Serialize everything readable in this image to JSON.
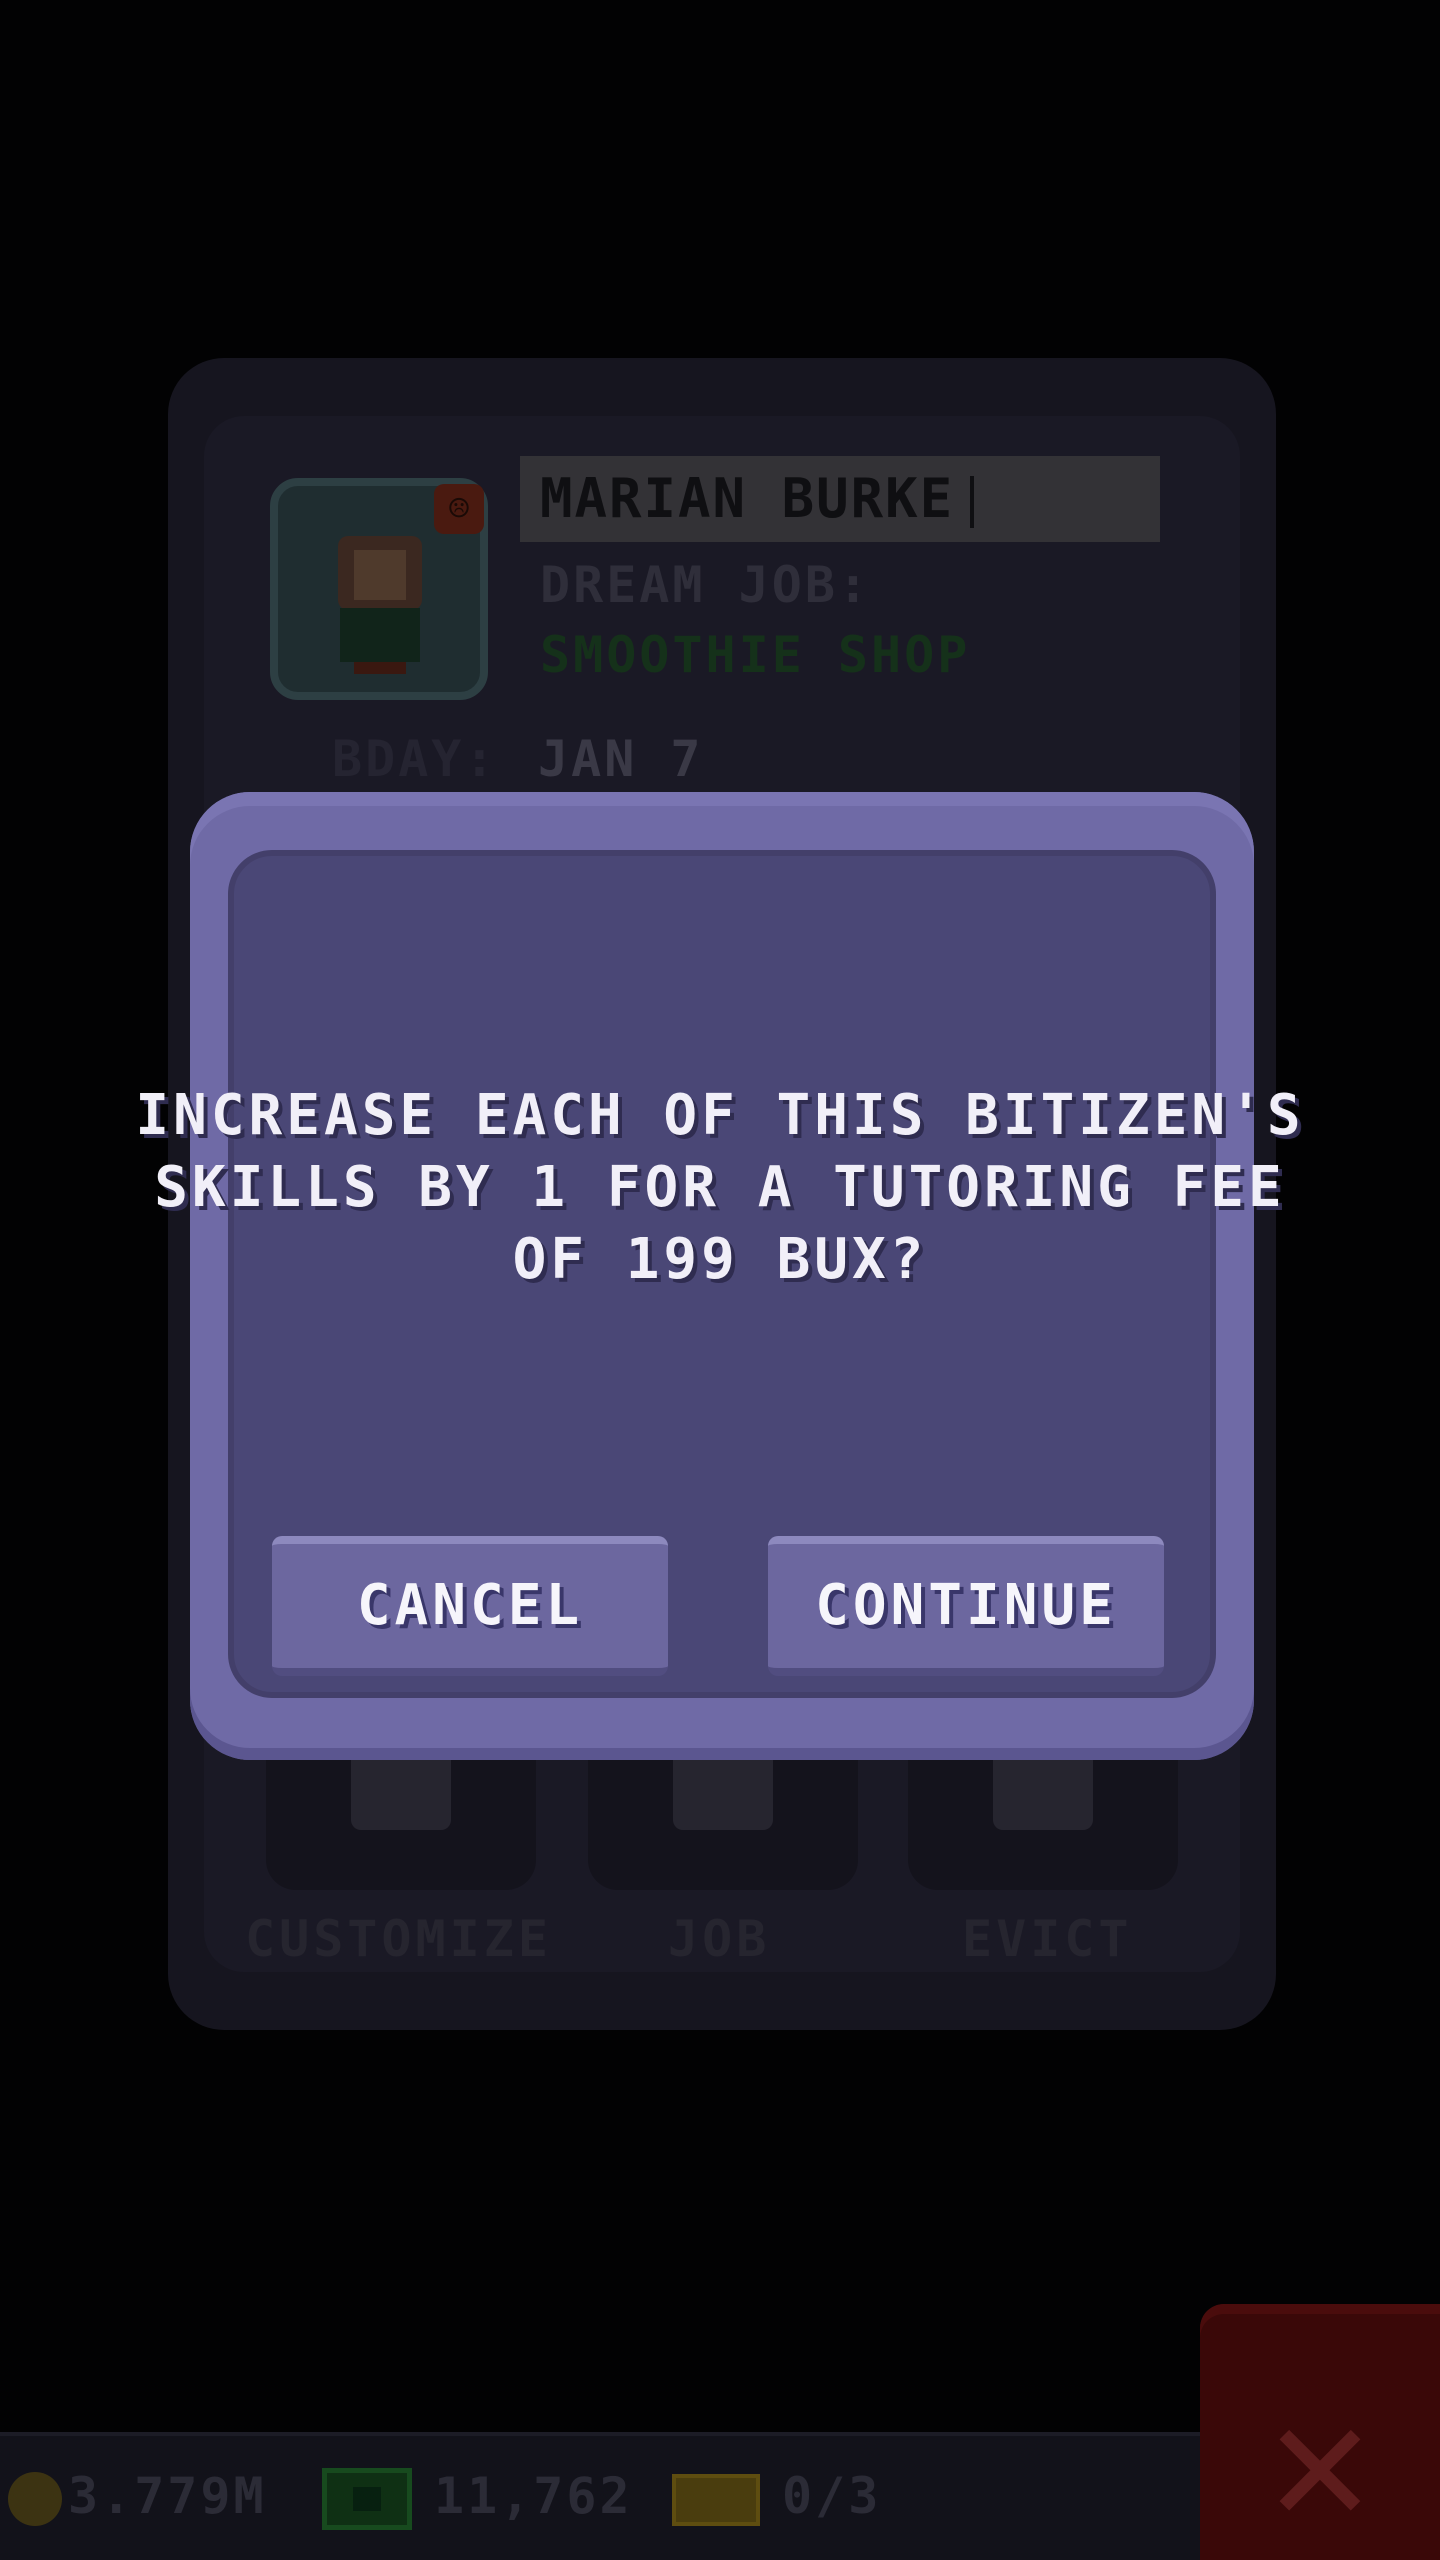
{
  "bitizen": {
    "name": "MARIAN BURKE",
    "dream_job_label": "DREAM JOB:",
    "dream_job_value": "SMOOTHIE SHOP",
    "bday_label": "BDAY:",
    "bday_value": "JAN 7",
    "mood_icon": "sad-face-icon",
    "actions": [
      {
        "label": "CUSTOMIZE",
        "icon": "customize-icon"
      },
      {
        "label": "JOB",
        "icon": "job-icon"
      },
      {
        "label": "EVICT",
        "icon": "evict-icon"
      }
    ]
  },
  "dialog": {
    "message": "INCREASE EACH OF THIS BITIZEN'S SKILLS BY 1 FOR A TUTORING FEE OF 199 BUX?",
    "cancel_label": "CANCEL",
    "continue_label": "CONTINUE"
  },
  "hud": {
    "coins": "3.779M",
    "bux": "11,762",
    "tickets": "0/3",
    "close_icon": "close-icon"
  },
  "colors": {
    "modal_frame": "#6f6aa6",
    "modal_fill": "#4a4776",
    "button": "#6c679f",
    "close": "#3a0808"
  }
}
